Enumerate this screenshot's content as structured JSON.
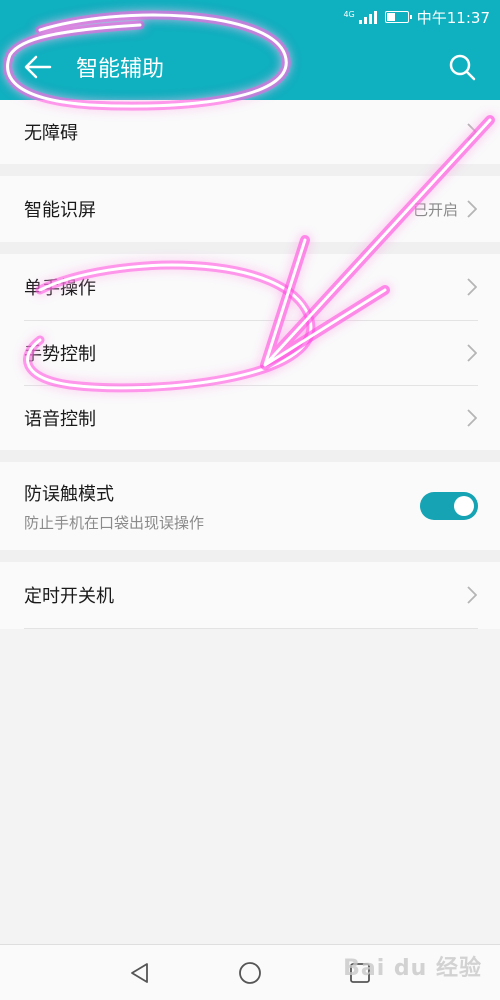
{
  "status_bar": {
    "network": "4G",
    "time": "中午11:37"
  },
  "app_bar": {
    "title": "智能辅助",
    "back_icon": "arrow-left-icon",
    "search_icon": "search-icon"
  },
  "groups": [
    {
      "rows": [
        {
          "label": "无障碍",
          "value": ""
        }
      ]
    },
    {
      "rows": [
        {
          "label": "智能识屏",
          "value": "已开启"
        }
      ]
    },
    {
      "rows": [
        {
          "label": "单手操作",
          "value": ""
        },
        {
          "label": "手势控制",
          "value": ""
        },
        {
          "label": "语音控制",
          "value": ""
        }
      ]
    },
    {
      "toggle_row": {
        "label": "防误触模式",
        "sublabel": "防止手机在口袋出现误操作",
        "enabled": true
      }
    },
    {
      "rows": [
        {
          "label": "定时开关机",
          "value": ""
        }
      ]
    }
  ],
  "nav_bar": {
    "back_icon": "triangle-back-icon",
    "home_icon": "circle-home-icon",
    "recent_icon": "square-recent-icon"
  },
  "watermark": "Bai du 经验",
  "colors": {
    "accent": "#0fb0bf",
    "toggle_on": "#16a3b3",
    "annotation_pink": "#ff3fe0"
  }
}
